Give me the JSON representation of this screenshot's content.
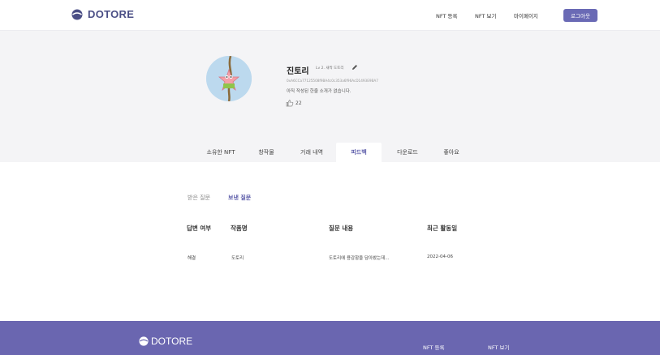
{
  "brand": {
    "name": "DOTORE"
  },
  "nav": {
    "items": [
      {
        "label": "NFT 등록"
      },
      {
        "label": "NFT 보기"
      },
      {
        "label": "마이페이지"
      }
    ],
    "logout_label": "로그아웃"
  },
  "profile": {
    "username": "진토리",
    "level": "Lv 2. 새싹 도토리",
    "wallet": "0xA6CCa77125508f9BA4c0c353a6f96AcD1493E9BA7",
    "intro": "아직 작성된 한줄 소개가 없습니다.",
    "likes": "22"
  },
  "tabs": [
    {
      "label": "소유한 NFT"
    },
    {
      "label": "창작물"
    },
    {
      "label": "거래 내역"
    },
    {
      "label": "피드백"
    },
    {
      "label": "다운로드"
    },
    {
      "label": "좋아요"
    }
  ],
  "active_tab": "피드백",
  "subtabs": [
    {
      "label": "받은 질문"
    },
    {
      "label": "보낸 질문"
    }
  ],
  "active_subtab": "보낸 질문",
  "table": {
    "headers": [
      "답변 여부",
      "작품명",
      "질문 내용",
      "최근 활동일"
    ],
    "rows": [
      {
        "status": "해결",
        "title": "도토리",
        "question": "도토리에 용감함을 담아봤는데...",
        "date": "2022-04-06"
      }
    ]
  },
  "footer": {
    "brand": "DOTORE",
    "links": [
      {
        "label": "NFT 등록"
      },
      {
        "label": "NFT 보기"
      }
    ]
  },
  "colors": {
    "accent": "#6a6ab5",
    "footer_bg": "#6a66b0",
    "profile_bg": "#f4f4f6"
  }
}
